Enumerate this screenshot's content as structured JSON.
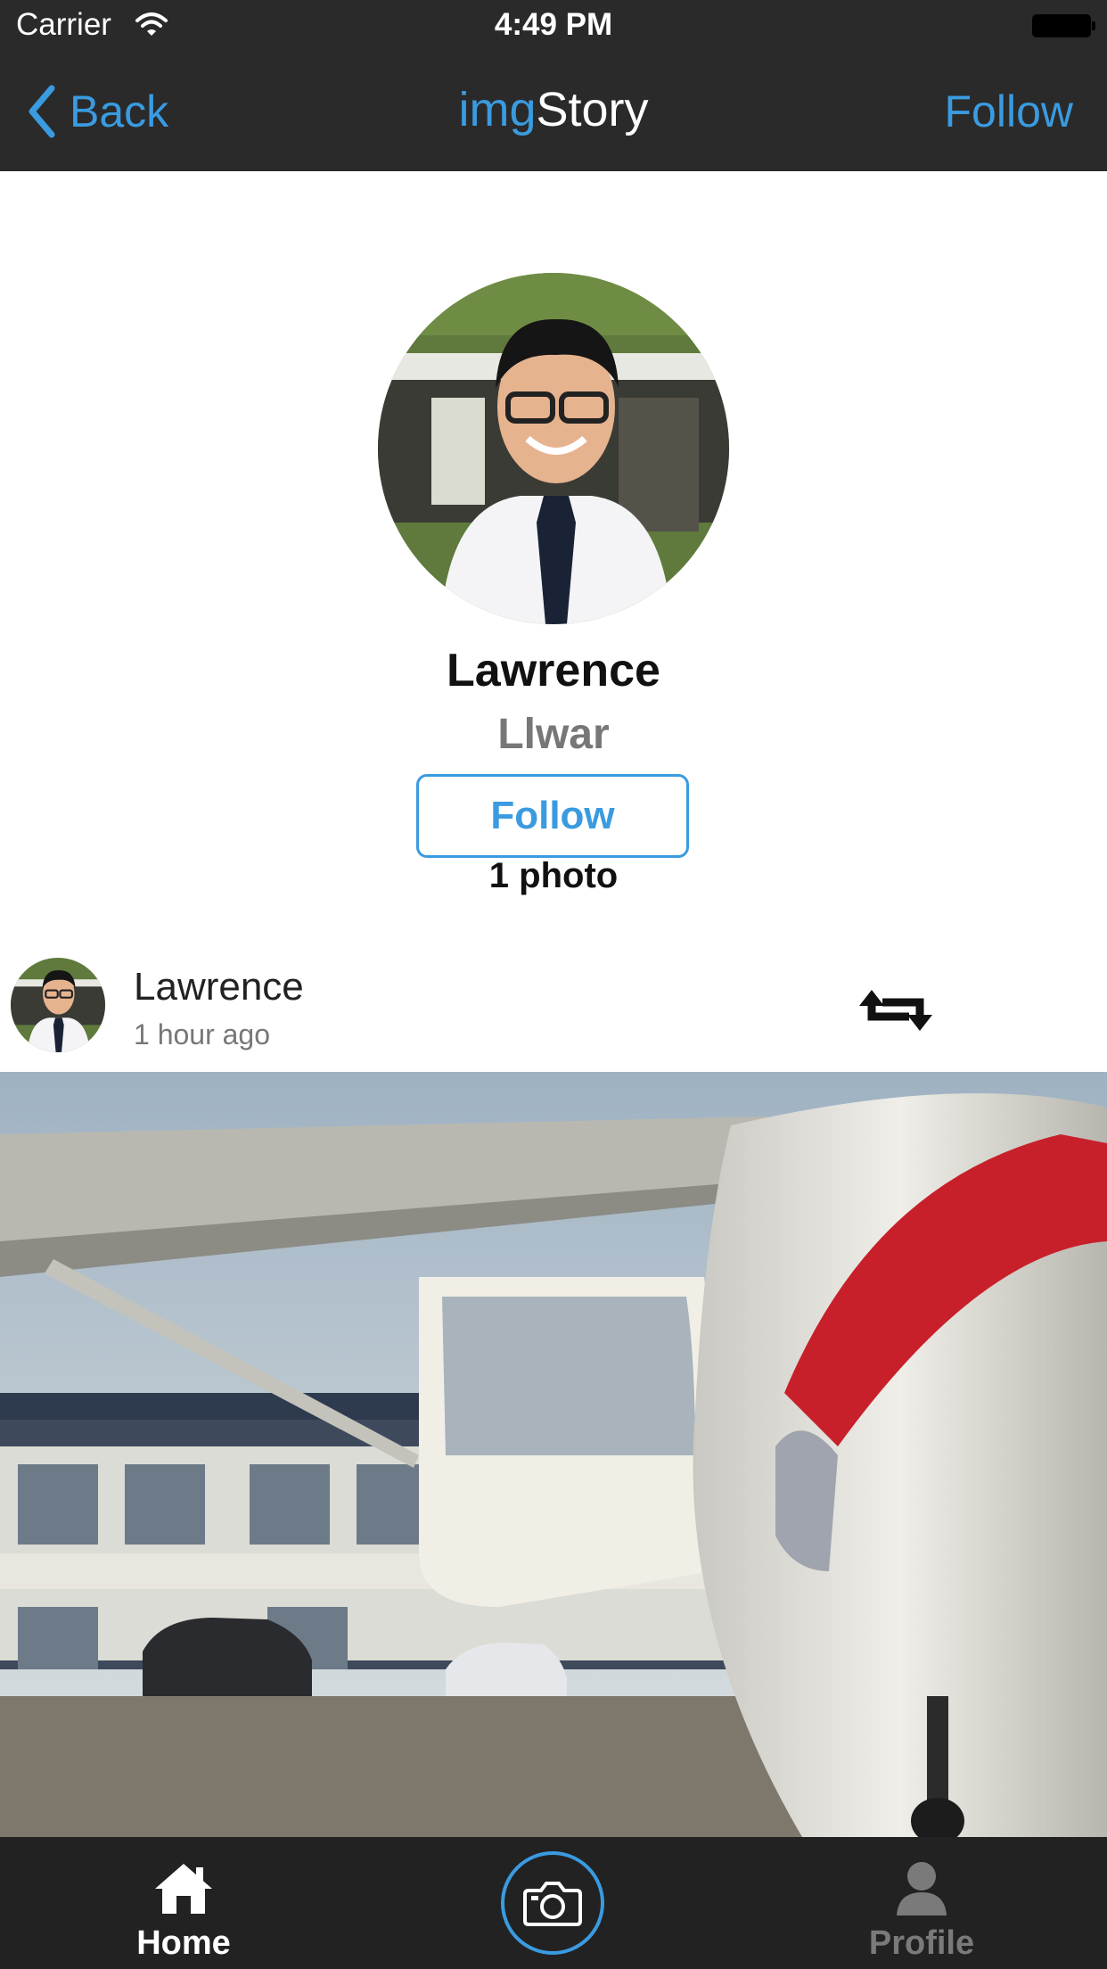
{
  "status_bar": {
    "carrier": "Carrier",
    "time": "4:49 PM"
  },
  "nav": {
    "back_label": "Back",
    "title_part1": "img",
    "title_part2": "Story",
    "follow_label": "Follow"
  },
  "profile": {
    "name": "Lawrence",
    "handle": "Llwar",
    "follow_label": "Follow",
    "photo_count": "1 photo"
  },
  "post": {
    "author": "Lawrence",
    "time": "1 hour ago"
  },
  "tabbar": {
    "home_label": "Home",
    "profile_label": "Profile"
  },
  "icons": {
    "back": "chevron-left-icon",
    "wifi": "wifi-icon",
    "battery": "battery-icon",
    "repost": "repost-icon",
    "home": "home-icon",
    "camera": "camera-icon",
    "profile": "person-icon"
  },
  "colors": {
    "accent": "#3a9be0",
    "bar_background": "#2a2a2a",
    "tabbar_background": "#222222"
  }
}
